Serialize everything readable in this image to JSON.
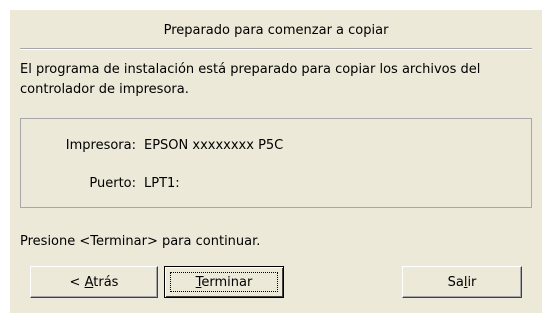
{
  "dialog": {
    "header": "Preparado para comenzar a copiar",
    "description": "El programa de instalación está preparado para copiar los archivos del controlador de impresora.",
    "info": {
      "printer_label": "Impresora:",
      "printer_value": "EPSON xxxxxxxx P5C",
      "port_label": "Puerto:",
      "port_value": "LPT1:"
    },
    "prompt": "Presione <Terminar> para continuar."
  },
  "buttons": {
    "back": {
      "pre": "< ",
      "accel": "A",
      "post": "trás"
    },
    "finish": {
      "pre": "",
      "accel": "T",
      "post": "erminar"
    },
    "exit": {
      "pre": "Sa",
      "accel": "l",
      "post": "ir"
    }
  }
}
